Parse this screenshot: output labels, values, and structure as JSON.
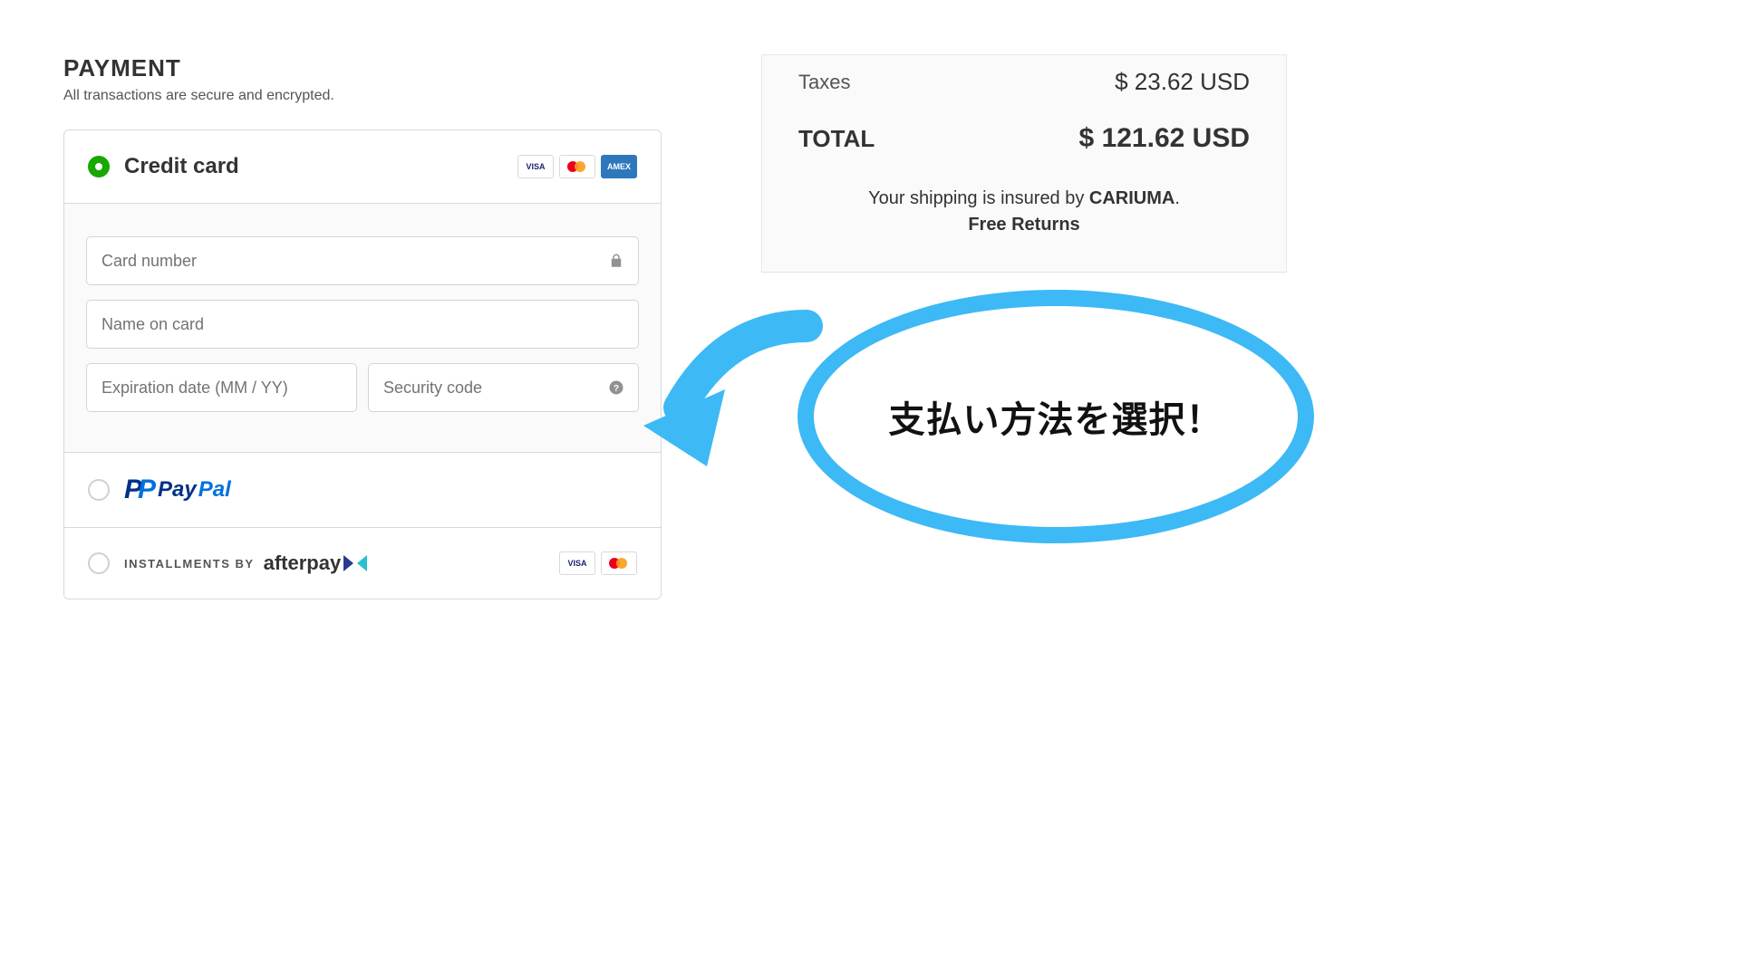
{
  "payment": {
    "title": "PAYMENT",
    "subtitle": "All transactions are secure and encrypted.",
    "options": {
      "creditCard": {
        "label": "Credit card"
      },
      "paypal": {
        "pay": "Pay",
        "pal": "Pal"
      },
      "afterpay": {
        "prefix": "INSTALLMENTS BY",
        "brand": "afterpay"
      }
    },
    "fields": {
      "cardNumber": "Card number",
      "nameOnCard": "Name on card",
      "expiry": "Expiration date (MM / YY)",
      "security": "Security code"
    },
    "cardBrands": {
      "visa": "VISA",
      "amex": "AMEX"
    }
  },
  "summary": {
    "taxesLabel": "Taxes",
    "taxesValue": "$ 23.62 USD",
    "totalLabel": "TOTAL",
    "totalValue": "$ 121.62 USD",
    "shipNotePrefix": "Your shipping is insured by ",
    "shipBrand": "CARIUMA",
    "shipNoteSuffix": ".",
    "freeReturns": "Free Returns"
  },
  "callout": {
    "text": "支払い方法を選択！"
  }
}
